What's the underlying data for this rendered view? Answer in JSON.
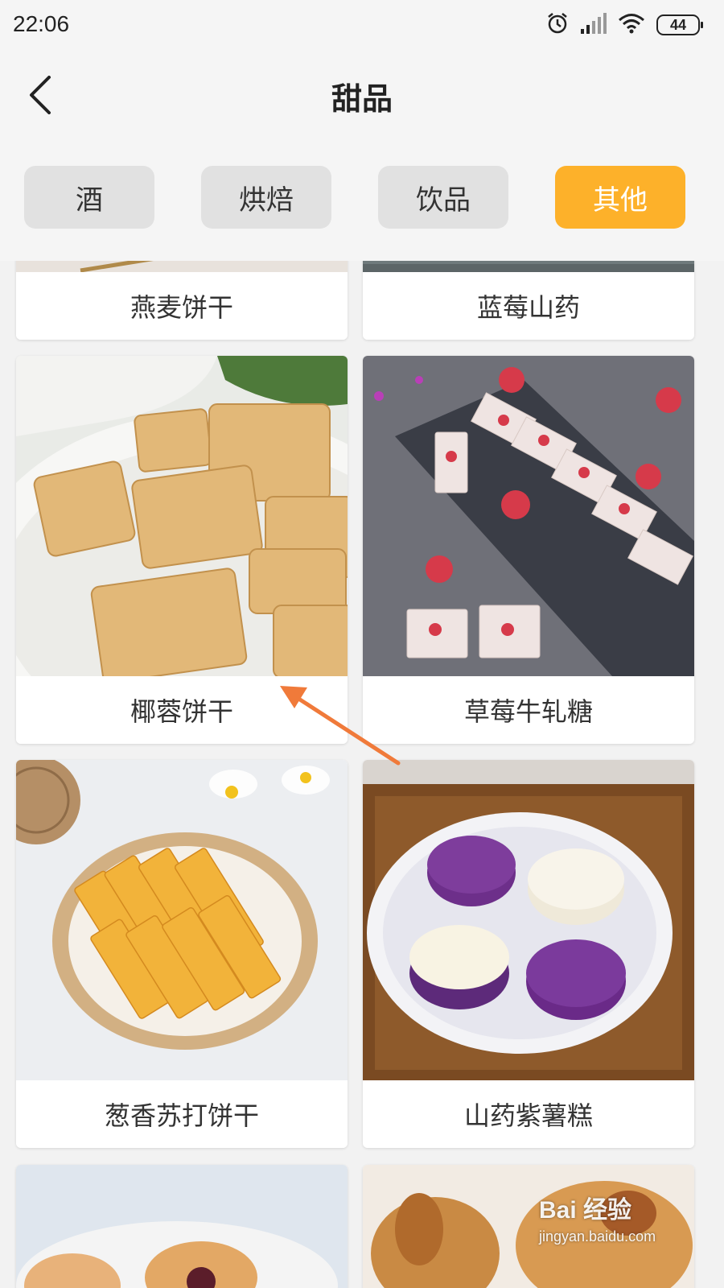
{
  "status_bar": {
    "time": "22:06",
    "battery": "44",
    "icons": [
      "alarm-icon",
      "signal-icon",
      "wifi-icon",
      "battery-icon"
    ]
  },
  "header": {
    "title": "甜品",
    "back_icon": "chevron-left-icon"
  },
  "tabs": [
    {
      "label": "酒",
      "active": false
    },
    {
      "label": "烘焙",
      "active": false
    },
    {
      "label": "饮品",
      "active": false
    },
    {
      "label": "其他",
      "active": true
    }
  ],
  "recipes": [
    {
      "name": "燕麦饼干"
    },
    {
      "name": "蓝莓山药"
    },
    {
      "name": "椰蓉饼干"
    },
    {
      "name": "草莓牛轧糖"
    },
    {
      "name": "葱香苏打饼干"
    },
    {
      "name": "山药紫薯糕"
    }
  ],
  "watermark": {
    "logo": "Bai 经验",
    "url": "jingyan.baidu.com"
  },
  "colors": {
    "accent": "#fdb12a",
    "tab_inactive": "#e1e1e1",
    "annotation_arrow": "#f07a3a"
  }
}
